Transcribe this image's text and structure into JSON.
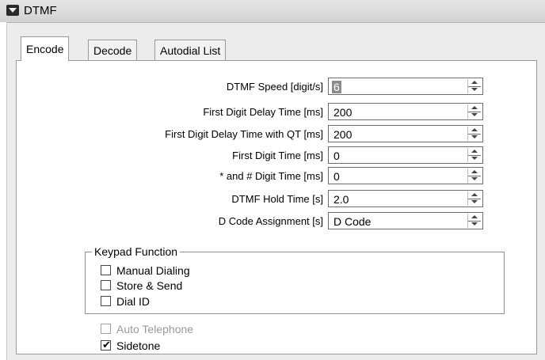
{
  "window": {
    "title": "DTMF"
  },
  "tabs": [
    {
      "label": "Encode",
      "active": true
    },
    {
      "label": "Decode",
      "active": false
    },
    {
      "label": "Autodial List",
      "active": false
    }
  ],
  "fields": [
    {
      "label": "DTMF Speed [digit/s]",
      "value": "6"
    },
    {
      "label": "First Digit Delay Time [ms]",
      "value": "200"
    },
    {
      "label": "First Digit Delay Time with QT [ms]",
      "value": "200"
    },
    {
      "label": "First Digit Time [ms]",
      "value": "0"
    },
    {
      "label": "* and # Digit Time [ms]",
      "value": "0"
    },
    {
      "label": "DTMF Hold Time [s]",
      "value": "2.0"
    },
    {
      "label": "D Code Assignment [s]",
      "value": "D Code"
    }
  ],
  "keypad": {
    "title": "Keypad Function",
    "options": [
      {
        "label": "Manual Dialing",
        "checked": false
      },
      {
        "label": "Store & Send",
        "checked": false
      },
      {
        "label": "Dial ID",
        "checked": false
      }
    ]
  },
  "extras": [
    {
      "label": "Auto Telephone",
      "checked": false,
      "disabled": true
    },
    {
      "label": "Sidetone",
      "checked": true,
      "disabled": false
    }
  ],
  "check_glyph": "✔"
}
